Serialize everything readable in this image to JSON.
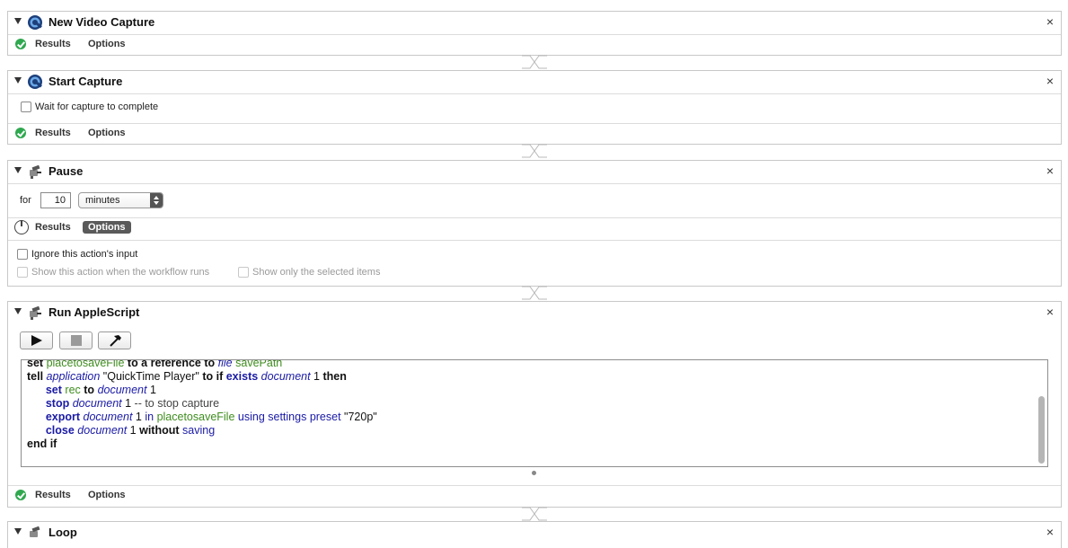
{
  "actions": [
    {
      "title": "New Video Capture",
      "tabs": {
        "results": "Results",
        "options": "Options"
      }
    },
    {
      "title": "Start Capture",
      "wait_checkbox_label": "Wait for capture to complete",
      "tabs": {
        "results": "Results",
        "options": "Options"
      }
    },
    {
      "title": "Pause",
      "for_label": "for",
      "duration_value": "10",
      "unit_selected": "minutes",
      "tabs": {
        "results": "Results",
        "options": "Options"
      },
      "ignore_input_label": "Ignore this action's input",
      "show_when_runs_label": "Show this action when the workflow runs",
      "show_selected_label": "Show only the selected items"
    },
    {
      "title": "Run AppleScript",
      "tabs": {
        "results": "Results",
        "options": "Options"
      },
      "script_lines": [
        "set placetosaveFile to a reference to file savePath",
        "tell application \"QuickTime Player\" to if exists document 1 then",
        "set rec to document 1",
        "stop document 1 -- to stop capture",
        "export document 1 in placetosaveFile using settings preset \"720p\"",
        "close document 1 without saving",
        "end if"
      ]
    },
    {
      "title": "Loop"
    }
  ],
  "close_glyph": "×",
  "colors": {
    "success": "#2fa84f",
    "active_tab": "#5a5a5a",
    "keyword_blue": "#1a1aa6",
    "variable_green": "#3f8d1f"
  }
}
